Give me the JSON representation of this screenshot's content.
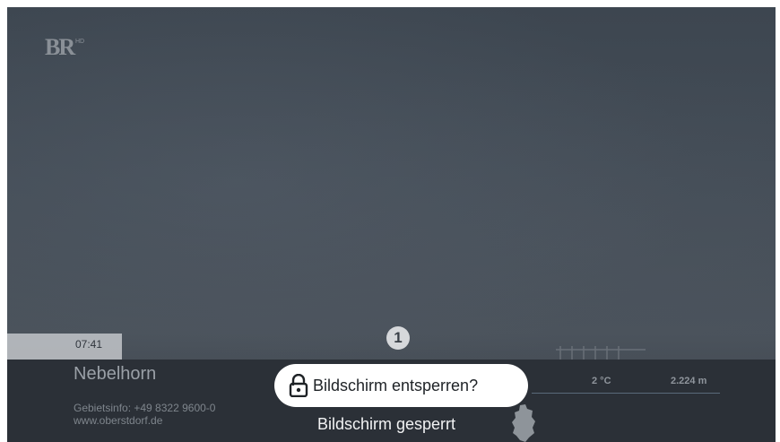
{
  "channel": {
    "logo": "BR",
    "quality": "HD"
  },
  "info": {
    "time": "07:41",
    "location": "Nebelhorn",
    "contact": "Gebietsinfo: +49 8322 9600-0",
    "website": "www.oberstdorf.de",
    "temperature": "2 °C",
    "altitude": "2.224 m"
  },
  "overlay": {
    "step_badge": "1",
    "unlock_label": "Bildschirm entsperren?",
    "locked_label": "Bildschirm gesperrt"
  },
  "icons": {
    "lock": "unlock-icon",
    "map": "germany-map-icon"
  },
  "colors": {
    "panel": "#2b3037",
    "time_box": "#cdd0d4",
    "button": "#ffffff",
    "line": "#5a6a7a"
  }
}
